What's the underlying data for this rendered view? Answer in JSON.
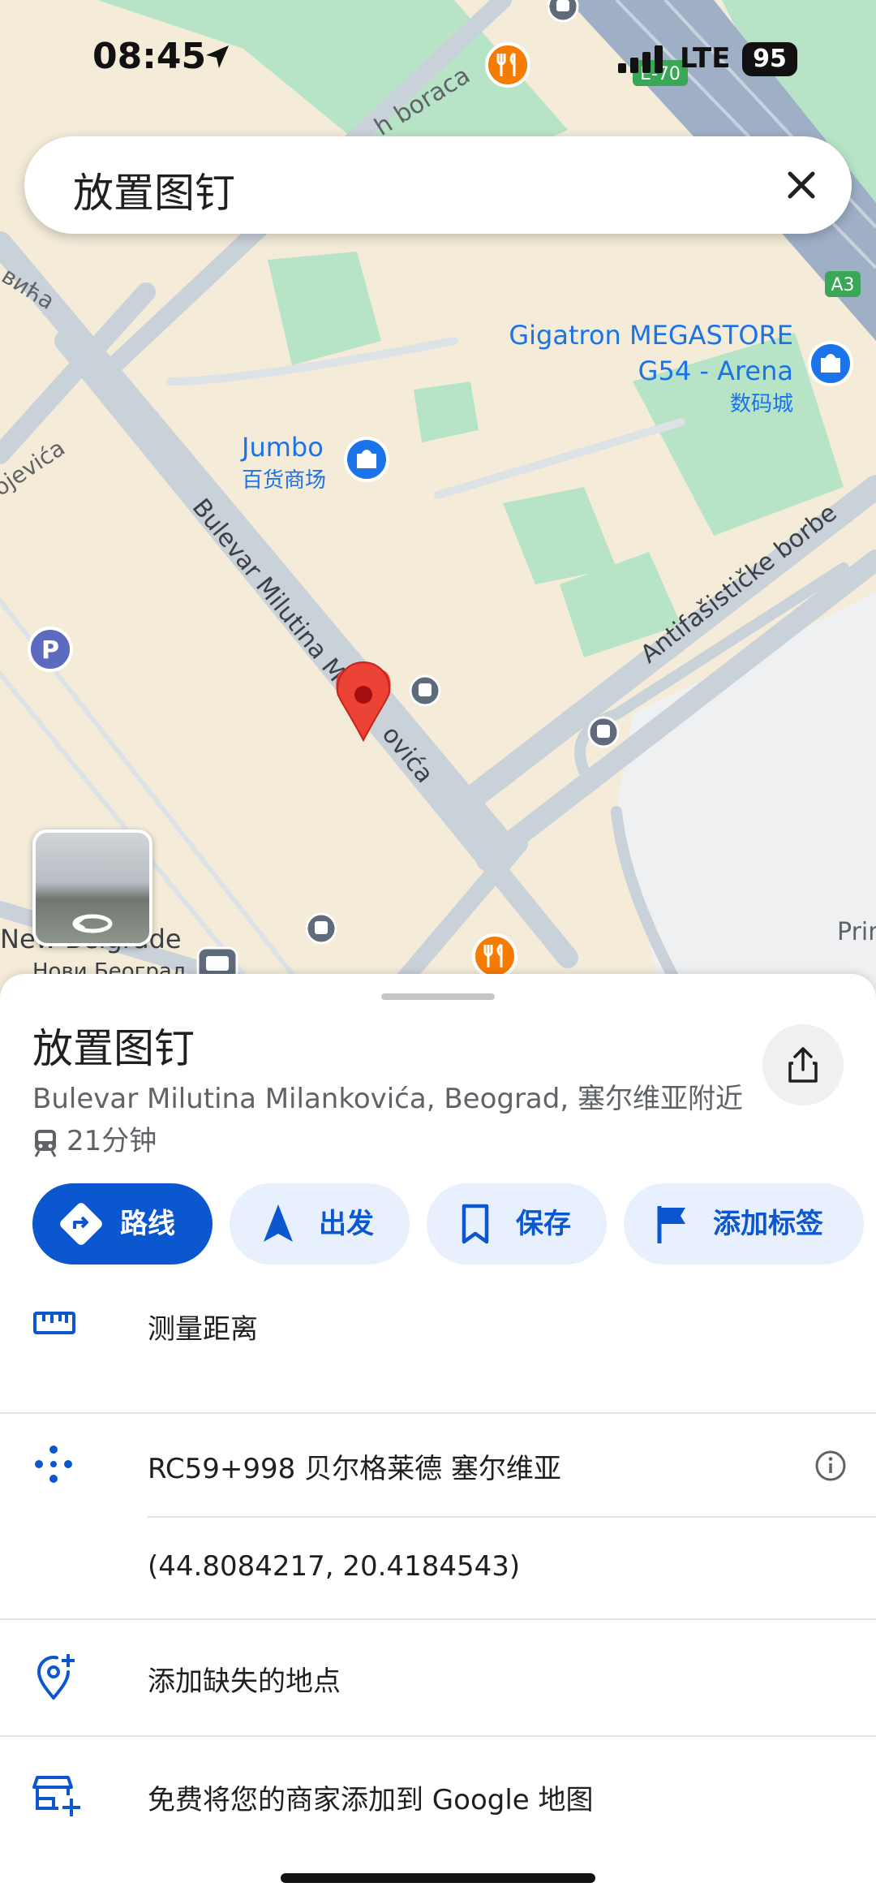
{
  "status_bar": {
    "time": "08:45",
    "network": "LTE",
    "battery": "95"
  },
  "search": {
    "query": "放置图钉",
    "close_icon": "close-icon"
  },
  "map": {
    "labels": {
      "street_boraca": "h boraca",
      "street_vica": "вића",
      "street_ojevica": "ojevića",
      "boulevard": "Bulevar Milutina Milankovića",
      "boulevard_a": "Bulevar Milutina M",
      "boulevard_b": "ovića",
      "antifasisticke": "Antifašističke borbe",
      "jumbo": "Jumbo",
      "jumbo_sub": "百货商场",
      "gigatron_1": "Gigatron MEGASTORE",
      "gigatron_2": "G54 - Arena",
      "gigatron_sub": "数码城",
      "new_belgrade": "New Belgrade",
      "new_belgrade_cyr": "Нови Београд",
      "prin": "Prin",
      "e70": "E-70",
      "a3": "A3",
      "parking": "P"
    },
    "colors": {
      "land": "#f4ecd9",
      "road": "#c9d1d9",
      "park": "#b7e4c7",
      "pin": "#ea4335",
      "poi_blue": "#1a73e8",
      "poi_orange": "#f57c00"
    }
  },
  "sheet": {
    "title": "放置图钉",
    "address": "Bulevar Milutina Milankovića, Beograd, 塞尔维亚附近",
    "transit_time": "21分钟",
    "actions": [
      {
        "label": "路线",
        "icon": "directions-icon"
      },
      {
        "label": "出发",
        "icon": "navigation-arrow-icon"
      },
      {
        "label": "保存",
        "icon": "bookmark-icon"
      },
      {
        "label": "添加标签",
        "icon": "flag-icon"
      }
    ],
    "rows": {
      "measure": "测量距离",
      "pluscode": "RC59+998 贝尔格莱德 塞尔维亚",
      "coords": "(44.8084217, 20.4184543)",
      "add_place": "添加缺失的地点",
      "add_business": "免费将您的商家添加到 Google 地图"
    }
  }
}
